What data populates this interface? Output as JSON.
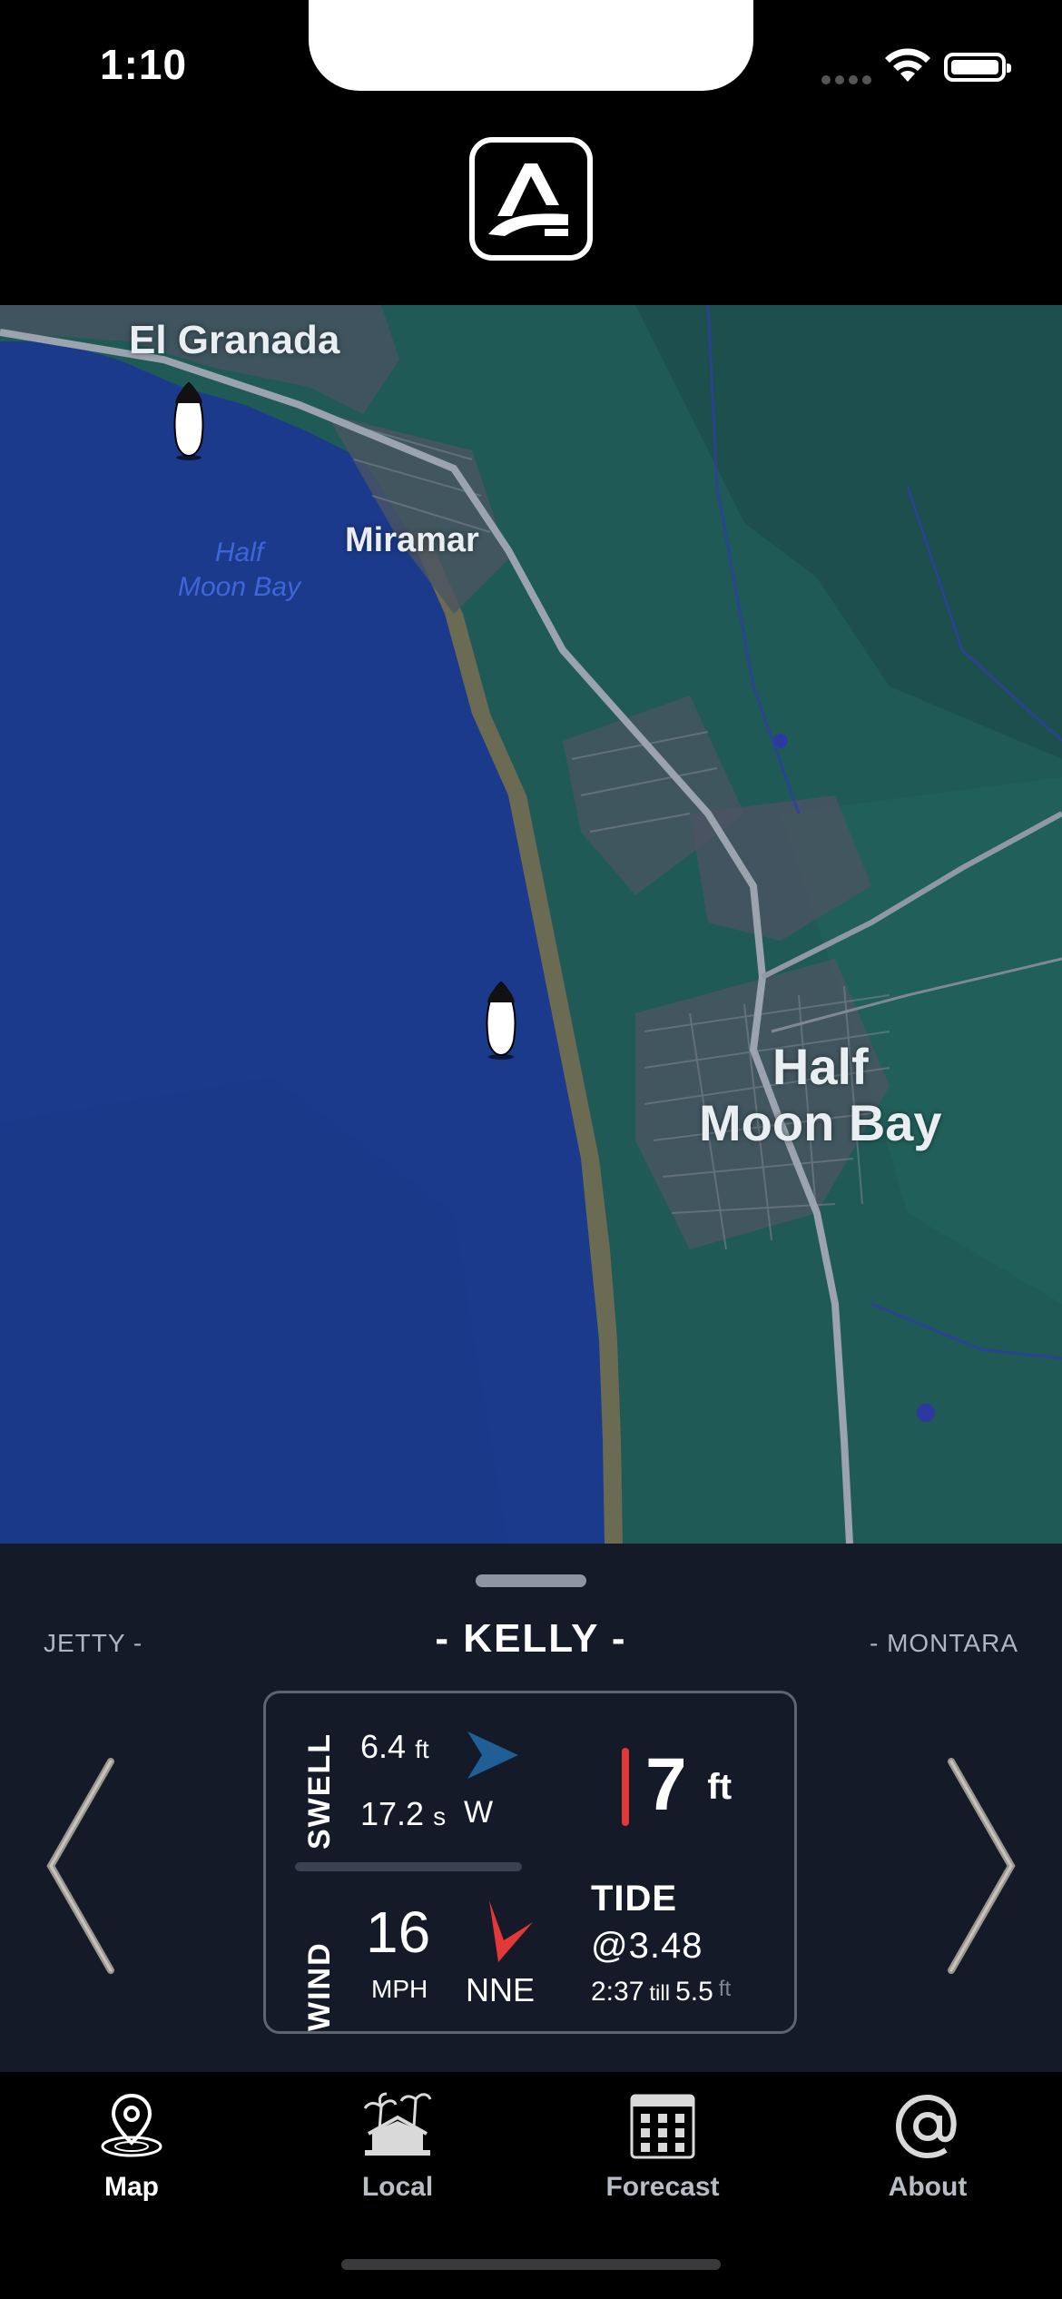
{
  "status_bar": {
    "time": "1:10"
  },
  "app": {
    "logo": "app-logo-icon"
  },
  "map": {
    "labels": {
      "el_granada": "El Granada",
      "miramar": "Miramar",
      "half_moon_bay_water_1": "Half",
      "half_moon_bay_water_2": "Moon Bay",
      "half_moon_bay_town_1": "Half",
      "half_moon_bay_town_2": "Moon Bay"
    },
    "markers": [
      "surfboard-marker",
      "surfboard-marker"
    ]
  },
  "spot": {
    "prev": "JETTY -",
    "current": "- KELLY -",
    "next": "- MONTARA"
  },
  "conditions": {
    "swell_label": "SWELL",
    "swell_height": "6.4",
    "swell_height_unit": "ft",
    "swell_period": "17.2",
    "swell_period_unit": "s",
    "swell_direction": "W",
    "surf_height": "7",
    "surf_height_unit": "ft",
    "wind_label": "WIND",
    "wind_speed": "16",
    "wind_unit": "MPH",
    "wind_direction": "NNE",
    "tide_label": "TIDE",
    "tide_current": "@3.48",
    "tide_next_time": "2:37",
    "tide_till": "till",
    "tide_next_height": "5.5",
    "tide_next_unit": "ft"
  },
  "colors": {
    "accent_red": "#e23838",
    "swell_arrow": "#1f5f95",
    "panel_bg": "#141a27"
  },
  "tabs": [
    {
      "label": "Map",
      "icon": "map-pin-icon",
      "active": true
    },
    {
      "label": "Local",
      "icon": "palm-house-icon",
      "active": false
    },
    {
      "label": "Forecast",
      "icon": "calendar-grid-icon",
      "active": false
    },
    {
      "label": "About",
      "icon": "at-sign-icon",
      "active": false
    }
  ]
}
